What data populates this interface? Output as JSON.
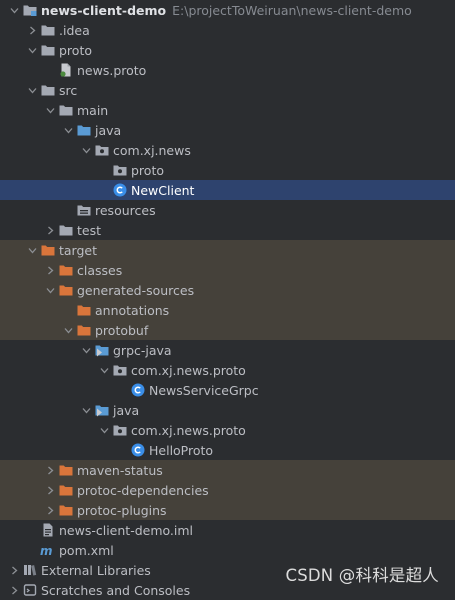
{
  "project_tree": [
    {
      "name": "news-client-demo",
      "path": "E:\\projectToWeiruan\\news-client-demo",
      "icon": "module-folder",
      "depth": 0,
      "expanded": true,
      "bold": true
    },
    {
      "name": ".idea",
      "icon": "folder",
      "depth": 1,
      "expanded": false
    },
    {
      "name": "proto",
      "icon": "folder",
      "depth": 1,
      "expanded": true
    },
    {
      "name": "news.proto",
      "icon": "proto-file",
      "depth": 2,
      "leaf": true
    },
    {
      "name": "src",
      "icon": "folder",
      "depth": 1,
      "expanded": true
    },
    {
      "name": "main",
      "icon": "folder",
      "depth": 2,
      "expanded": true
    },
    {
      "name": "java",
      "icon": "source-folder",
      "depth": 3,
      "expanded": true
    },
    {
      "name": "com.xj.news",
      "icon": "package",
      "depth": 4,
      "expanded": true
    },
    {
      "name": "proto",
      "icon": "package",
      "depth": 5,
      "leaf": true
    },
    {
      "name": "NewClient",
      "icon": "class",
      "depth": 5,
      "leaf": true,
      "selected": true
    },
    {
      "name": "resources",
      "icon": "resources-folder",
      "depth": 3,
      "leaf": true
    },
    {
      "name": "test",
      "icon": "folder",
      "depth": 2,
      "expanded": false
    },
    {
      "name": "target",
      "icon": "excluded-folder",
      "depth": 1,
      "expanded": true,
      "highlight": true
    },
    {
      "name": "classes",
      "icon": "excluded-folder",
      "depth": 2,
      "expanded": false,
      "highlight": true
    },
    {
      "name": "generated-sources",
      "icon": "excluded-folder",
      "depth": 2,
      "expanded": true,
      "highlight": true
    },
    {
      "name": "annotations",
      "icon": "excluded-folder",
      "depth": 3,
      "leaf": true,
      "highlight": true
    },
    {
      "name": "protobuf",
      "icon": "excluded-folder",
      "depth": 3,
      "expanded": true,
      "highlight": true
    },
    {
      "name": "grpc-java",
      "icon": "generated-source-folder",
      "depth": 4,
      "expanded": true
    },
    {
      "name": "com.xj.news.proto",
      "icon": "package",
      "depth": 5,
      "expanded": true
    },
    {
      "name": "NewsServiceGrpc",
      "icon": "class",
      "depth": 6,
      "leaf": true
    },
    {
      "name": "java",
      "icon": "generated-source-folder",
      "depth": 4,
      "expanded": true
    },
    {
      "name": "com.xj.news.proto",
      "icon": "package",
      "depth": 5,
      "expanded": true
    },
    {
      "name": "HelloProto",
      "icon": "class",
      "depth": 6,
      "leaf": true
    },
    {
      "name": "maven-status",
      "icon": "excluded-folder",
      "depth": 2,
      "expanded": false,
      "highlight": true
    },
    {
      "name": "protoc-dependencies",
      "icon": "excluded-folder",
      "depth": 2,
      "expanded": false,
      "highlight": true
    },
    {
      "name": "protoc-plugins",
      "icon": "excluded-folder",
      "depth": 2,
      "expanded": false,
      "highlight": true
    },
    {
      "name": "news-client-demo.iml",
      "icon": "iml-file",
      "depth": 1,
      "leaf": true
    },
    {
      "name": "pom.xml",
      "icon": "maven-file",
      "depth": 1,
      "leaf": true
    },
    {
      "name": "External Libraries",
      "icon": "libraries",
      "depth": 0,
      "expanded": false
    },
    {
      "name": "Scratches and Consoles",
      "icon": "scratches",
      "depth": 0,
      "expanded": false
    }
  ],
  "colors": {
    "background": "#2b2d30",
    "selection": "#2e436e",
    "excluded_highlight": "#45413a",
    "folder": "#a4a9b3",
    "source_folder": "#5a9bd4",
    "excluded_folder": "#d9753b",
    "class_icon": "#3a8ee8"
  },
  "watermark": "CSDN @科科是超人"
}
